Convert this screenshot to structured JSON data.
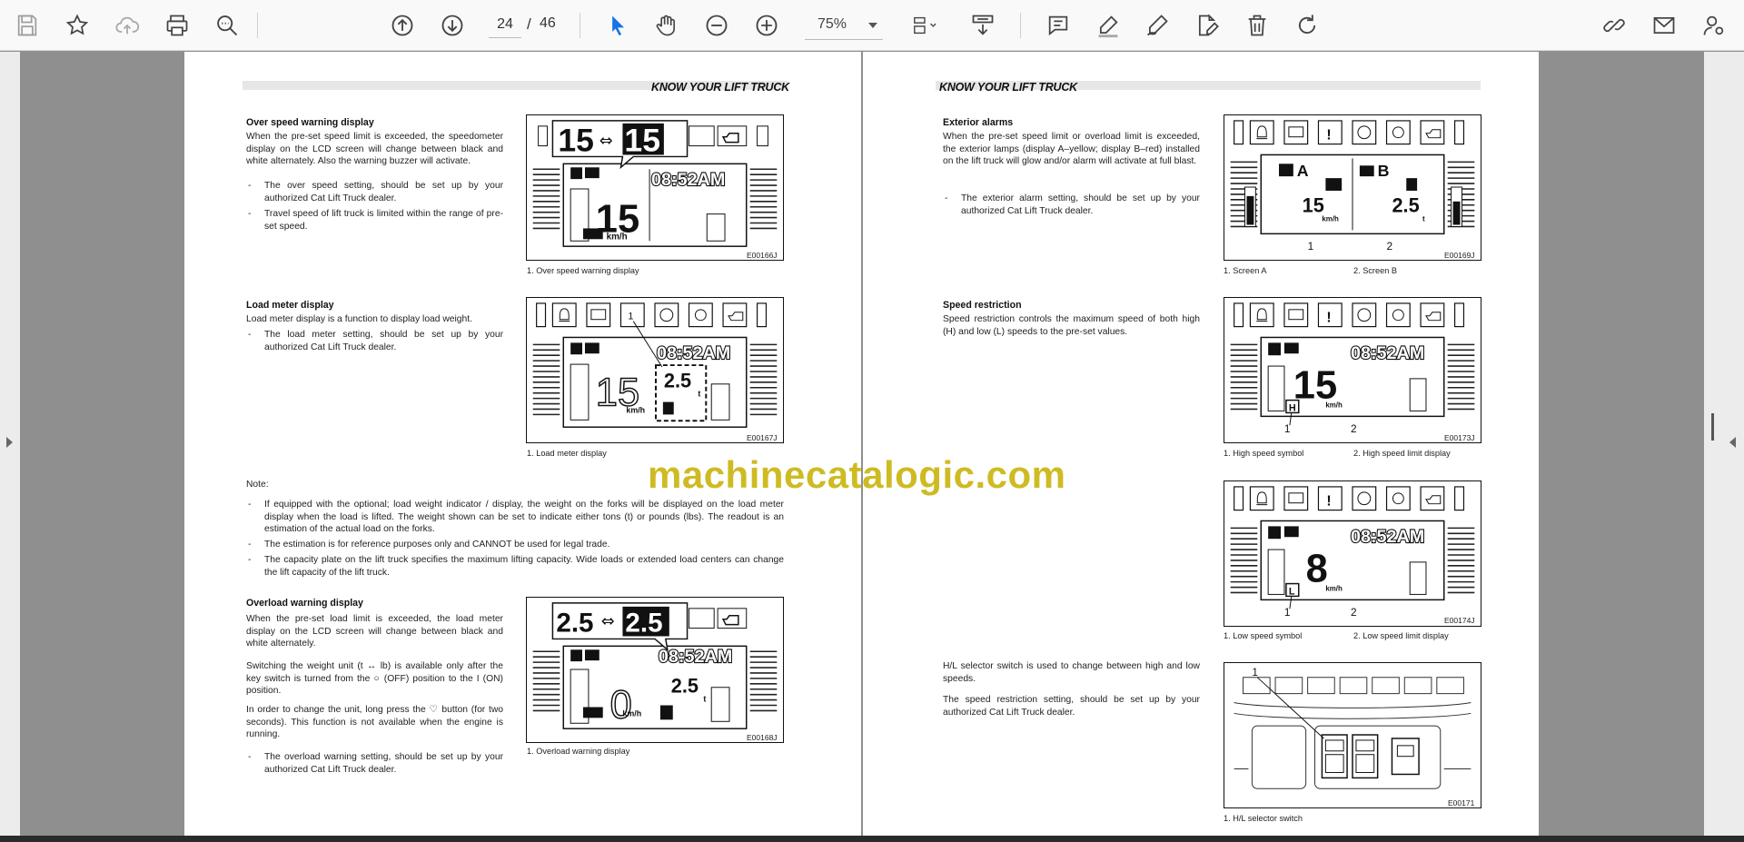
{
  "toolbar": {
    "icons": [
      "save-icon",
      "bookmark-star-icon",
      "cloud-upload-icon",
      "print-icon",
      "zoom-out-icon",
      "page-up-icon",
      "page-down-icon",
      "select-cursor-icon",
      "hand-pan-icon",
      "zoom-minus-icon",
      "zoom-plus-icon",
      "page-layout-icon",
      "extract-icon",
      "comment-icon",
      "highlight-pen-icon",
      "sign-pen-icon",
      "edit-document-icon",
      "delete-icon",
      "rotate-icon",
      "share-link-icon",
      "email-icon",
      "user-settings-icon"
    ],
    "page_current": "24",
    "page_separator": "/",
    "page_total": "46",
    "zoom": "75%",
    "accent_color": "#1473e6"
  },
  "left_page": {
    "header": "KNOW YOUR LIFT TRUCK",
    "over_speed": {
      "title": "Over speed warning display",
      "text": "When the pre-set speed limit is exceeded, the speedometer display on the LCD screen will change between black and white alternately. Also the warning buzzer will activate.",
      "bullets": [
        "The over speed setting, should be set up by your authorized Cat Lift Truck dealer.",
        "Travel speed of lift truck is limited within the range of pre-set speed."
      ],
      "fig_code": "E00166J",
      "caption": "1. Over speed warning display",
      "fig_speed": "15",
      "fig_time": "08:52AM",
      "fig_unit": "km/h"
    },
    "load_meter": {
      "title": "Load meter display",
      "text": "Load meter display is a function to display load weight.",
      "bullets": [
        "The load meter setting, should be set up by your authorized Cat Lift Truck dealer."
      ],
      "fig_code": "E00167J",
      "caption": "1. Load meter display",
      "fig_load": "2.5",
      "fig_load_unit": "t",
      "fig_callout": "1"
    },
    "note": {
      "label": "Note:",
      "bullets": [
        "If equipped with the optional; load weight indicator / display, the weight on the forks will be displayed on the load meter display when the load is lifted. The weight shown can be set to indicate either tons (t) or pounds (lbs). The readout is an estimation of the actual load on the forks.",
        "The estimation is for reference purposes only and CANNOT be used for legal trade.",
        "The capacity plate on the lift truck specifies the maximum lifting capacity. Wide loads or extended load centers can change the lift capacity of the lift truck."
      ]
    },
    "overload": {
      "title": "Overload warning display",
      "text1": "When the pre-set load limit is exceeded, the load meter display on the LCD screen will change between black and white alternately.",
      "text2": "Switching the weight unit (t ↔ lb) is available only after the key switch is turned from the ○ (OFF) position to the I (ON) position.",
      "text3": "In order to change the unit, long press the ♡ button (for two seconds). This function is not available when the engine is running.",
      "bullets": [
        "The overload warning setting, should be set up by your authorized Cat Lift Truck dealer."
      ],
      "fig_code": "E00168J",
      "caption": "1. Overload warning display",
      "fig_zero": "0"
    }
  },
  "right_page": {
    "header": "KNOW YOUR LIFT TRUCK",
    "exterior": {
      "title": "Exterior alarms",
      "text": "When the pre-set speed limit or overload limit is exceeded, the exterior lamps (display A–yellow; display B–red) installed on the lift truck will glow and/or alarm will activate at full blast.",
      "bullets": [
        "The exterior alarm setting, should be set up by your authorized Cat Lift Truck dealer."
      ],
      "fig_code": "E00169J",
      "caption1": "1. Screen A",
      "caption2": "2. Screen B",
      "label_a": "A",
      "label_b": "B",
      "num1": "1",
      "num2": "2"
    },
    "speed_restriction": {
      "title": "Speed restriction",
      "text": "Speed restriction controls the maximum speed of both high (H) and low (L) speeds to the pre-set values.",
      "fig1_code": "E00173J",
      "fig1_caption1": "1. High speed symbol",
      "fig1_caption2": "2. High speed limit display",
      "fig1_letter": "H",
      "fig2_code": "E00174J",
      "fig2_caption1": "1. Low speed symbol",
      "fig2_caption2": "2. Low speed limit display",
      "fig2_speed": "8",
      "fig2_letter": "L"
    },
    "hl_switch": {
      "text1": "H/L selector switch is used to change between high and low speeds.",
      "text2": "The speed restriction setting, should be set up by your authorized Cat Lift Truck dealer.",
      "fig_code": "E00171",
      "caption": "1. H/L selector switch"
    }
  },
  "watermark": "machinecatalogic.com"
}
